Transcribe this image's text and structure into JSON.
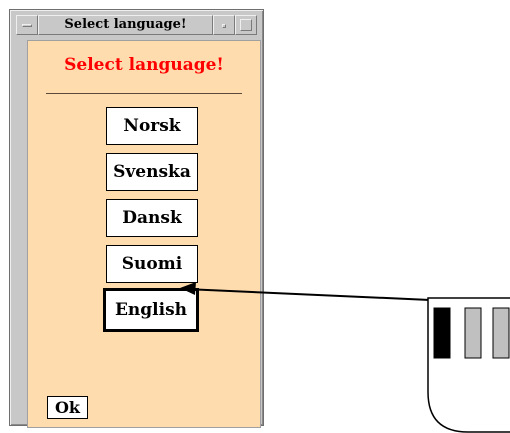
{
  "window": {
    "title": "Select language!"
  },
  "dialog": {
    "heading": "Select language!",
    "languages": [
      {
        "label": "Norsk"
      },
      {
        "label": "Svenska"
      },
      {
        "label": "Dansk"
      },
      {
        "label": "Suomi"
      },
      {
        "label": "English",
        "selected": true
      }
    ],
    "ok_label": "Ok"
  },
  "colors": {
    "client_background": "#ffdcae",
    "heading": "#ff0000",
    "pressed_mouse_button": "#000000",
    "idle_mouse_button": "#c0c0c0"
  },
  "icons": {
    "window_menu": "window-menu-icon",
    "minimize": "minimize-icon",
    "maximize": "maximize-icon",
    "mouse": "mouse-icon"
  },
  "mouse": {
    "pressed_button": "left"
  }
}
